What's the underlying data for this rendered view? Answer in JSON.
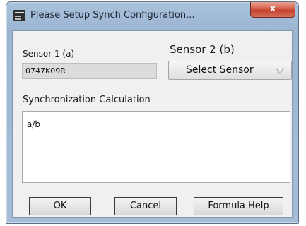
{
  "window": {
    "title": "Please Setup Synch Configuration...",
    "close_label": "x"
  },
  "sensor1": {
    "label": "Sensor 1 (a)",
    "value": "0747K09R"
  },
  "sensor2": {
    "label": "Sensor 2 (b)",
    "select_label": "Select Sensor"
  },
  "calculation": {
    "label": "Synchronization Calculation",
    "value": "a/b"
  },
  "buttons": {
    "ok": "OK",
    "cancel": "Cancel",
    "formula_help": "Formula Help"
  },
  "icons": {
    "app": "app-window-icon",
    "close": "close-icon",
    "dropdown": "chevron-down-icon"
  },
  "colors": {
    "title_bar": "#a9c2dc",
    "close_button": "#c2412c",
    "client_background": "#f0f0f0"
  }
}
